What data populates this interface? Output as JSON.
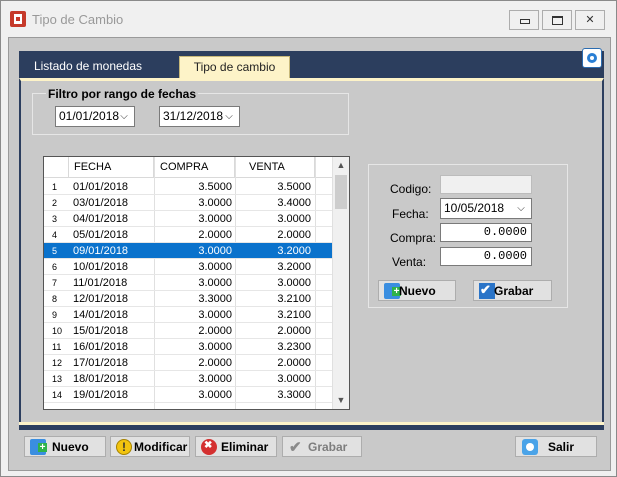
{
  "window": {
    "title": "Tipo de Cambio"
  },
  "tabs": [
    {
      "label": "Listado de monedas",
      "active": false
    },
    {
      "label": "Tipo de cambio",
      "active": true
    }
  ],
  "filter": {
    "label": "Filtro por rango de fechas",
    "from": "01/01/2018",
    "to": "31/12/2018"
  },
  "grid": {
    "columns": [
      "FECHA",
      "COMPRA",
      "VENTA"
    ],
    "selected_row": 5,
    "rows": [
      {
        "n": "1",
        "fecha": "01/01/2018",
        "compra": "3.5000",
        "venta": "3.5000"
      },
      {
        "n": "2",
        "fecha": "03/01/2018",
        "compra": "3.0000",
        "venta": "3.4000"
      },
      {
        "n": "3",
        "fecha": "04/01/2018",
        "compra": "3.0000",
        "venta": "3.0000"
      },
      {
        "n": "4",
        "fecha": "05/01/2018",
        "compra": "2.0000",
        "venta": "2.0000"
      },
      {
        "n": "5",
        "fecha": "09/01/2018",
        "compra": "3.0000",
        "venta": "3.2000"
      },
      {
        "n": "6",
        "fecha": "10/01/2018",
        "compra": "3.0000",
        "venta": "3.2000"
      },
      {
        "n": "7",
        "fecha": "11/01/2018",
        "compra": "3.0000",
        "venta": "3.0000"
      },
      {
        "n": "8",
        "fecha": "12/01/2018",
        "compra": "3.3000",
        "venta": "3.2100"
      },
      {
        "n": "9",
        "fecha": "14/01/2018",
        "compra": "3.0000",
        "venta": "3.2100"
      },
      {
        "n": "10",
        "fecha": "15/01/2018",
        "compra": "2.0000",
        "venta": "2.0000"
      },
      {
        "n": "11",
        "fecha": "16/01/2018",
        "compra": "3.0000",
        "venta": "3.2300"
      },
      {
        "n": "12",
        "fecha": "17/01/2018",
        "compra": "2.0000",
        "venta": "2.0000"
      },
      {
        "n": "13",
        "fecha": "18/01/2018",
        "compra": "3.0000",
        "venta": "3.0000"
      },
      {
        "n": "14",
        "fecha": "19/01/2018",
        "compra": "3.0000",
        "venta": "3.3000"
      }
    ]
  },
  "form": {
    "codigo_label": "Codigo:",
    "codigo_value": "",
    "fecha_label": "Fecha:",
    "fecha_value": "10/05/2018",
    "compra_label": "Compra:",
    "compra_value": "0.0000",
    "venta_label": "Venta:",
    "venta_value": "0.0000",
    "nuevo_label": "Nuevo",
    "grabar_label": "Grabar"
  },
  "toolbar": {
    "nuevo_label": "Nuevo",
    "modificar_label": "Modificar",
    "eliminar_label": "Eliminar",
    "grabar_label": "Grabar",
    "salir_label": "Salir"
  },
  "icons": {
    "app": "currency-exchange-icon",
    "settings": "gear-icon",
    "new": "new-record-icon",
    "edit": "warning-edit-icon",
    "delete": "delete-icon",
    "save": "checkmark-icon",
    "exit": "exit-icon"
  },
  "colors": {
    "tab_bar": "#2c3e5e",
    "active_tab": "#fdf3c8",
    "selection": "#0a72cc",
    "client_bg": "#c9c9c9"
  }
}
